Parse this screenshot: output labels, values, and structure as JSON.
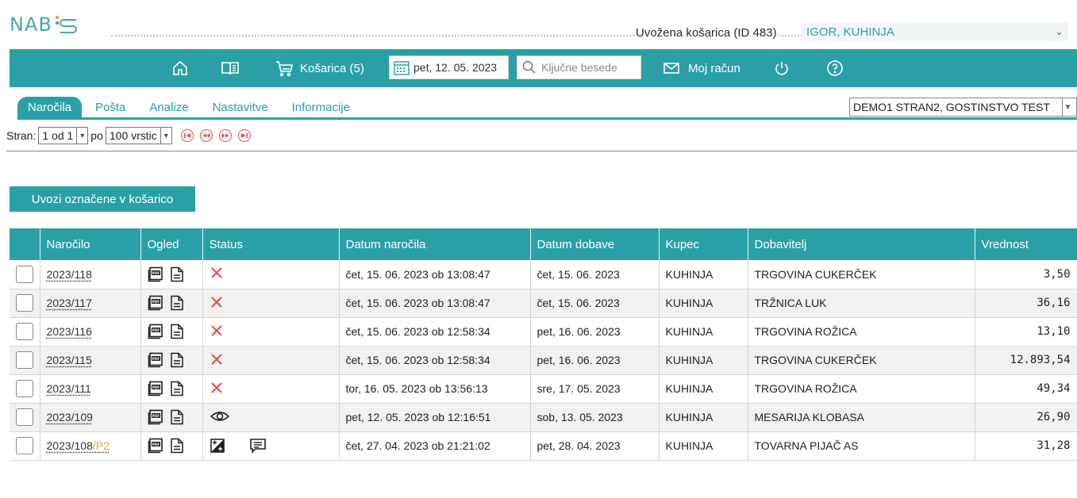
{
  "logo": {
    "text": "NAB",
    "s": "S"
  },
  "imported_cart": {
    "label": "Uvožena košarica (ID 483)",
    "value": "IGOR, KUHINJA"
  },
  "navbar": {
    "cart_label": "Košarica (5)",
    "date": "pet, 12. 05. 2023",
    "search_placeholder": "Ključne besede",
    "account_label": "Moj račun",
    "icons": [
      "home-icon",
      "catalog-book-icon",
      "cart-icon",
      "calendar-icon",
      "search-icon",
      "mail-icon",
      "power-icon",
      "help-icon"
    ]
  },
  "tabs": [
    {
      "label": "Naročila",
      "active": true
    },
    {
      "label": "Pošta",
      "active": false
    },
    {
      "label": "Analize",
      "active": false
    },
    {
      "label": "Nastavitve",
      "active": false
    },
    {
      "label": "Informacije",
      "active": false
    }
  ],
  "company": {
    "value": "DEMO1 STRAN2, GOSTINSTVO TEST"
  },
  "pager": {
    "label": "Stran:",
    "page": "1 od 1",
    "per_label": "po",
    "rows": "100 vrstic"
  },
  "import_button": "Uvozi označene v košarico",
  "table": {
    "headers": [
      "",
      "Naročilo",
      "Ogled",
      "Status",
      "Datum naročila",
      "Datum dobave",
      "Kupec",
      "Dobavitelj",
      "Vrednost"
    ],
    "rows": [
      {
        "order": "2023/118",
        "suffix": "",
        "status": "cancelled",
        "ordered": "čet, 15. 06. 2023 ob 13:08:47",
        "delivery": "čet, 15. 06. 2023",
        "buyer": "KUHINJA",
        "supplier": "TRGOVINA CUKERČEK",
        "value": "3,50"
      },
      {
        "order": "2023/117",
        "suffix": "",
        "status": "cancelled",
        "ordered": "čet, 15. 06. 2023 ob 13:08:47",
        "delivery": "čet, 15. 06. 2023",
        "buyer": "KUHINJA",
        "supplier": "TRŽNICA LUK",
        "value": "36,16"
      },
      {
        "order": "2023/116",
        "suffix": "",
        "status": "cancelled",
        "ordered": "čet, 15. 06. 2023 ob 12:58:34",
        "delivery": "pet, 16. 06. 2023",
        "buyer": "KUHINJA",
        "supplier": "TRGOVINA ROŽICA",
        "value": "13,10"
      },
      {
        "order": "2023/115",
        "suffix": "",
        "status": "cancelled",
        "ordered": "čet, 15. 06. 2023 ob 12:58:34",
        "delivery": "pet, 16. 06. 2023",
        "buyer": "KUHINJA",
        "supplier": "TRGOVINA CUKERČEK",
        "value": "12.893,54"
      },
      {
        "order": "2023/111",
        "suffix": "",
        "status": "cancelled",
        "ordered": "tor, 16. 05. 2023 ob 13:56:13",
        "delivery": "sre, 17. 05. 2023",
        "buyer": "KUHINJA",
        "supplier": "TRGOVINA ROŽICA",
        "value": "49,34"
      },
      {
        "order": "2023/109",
        "suffix": "",
        "status": "viewed",
        "ordered": "pet, 12. 05. 2023 ob 12:16:51",
        "delivery": "sob, 13. 05. 2023",
        "buyer": "KUHINJA",
        "supplier": "MESARIJA KLOBASA",
        "value": "26,90"
      },
      {
        "order": "2023/108",
        "suffix": "/P2",
        "status": "edited",
        "ordered": "čet, 27. 04. 2023 ob 21:21:02",
        "delivery": "pet, 28. 04. 2023",
        "buyer": "KUHINJA",
        "supplier": "TOVARNA PIJAČ AS",
        "value": "31,28"
      }
    ]
  },
  "colors": {
    "accent": "#2aa0a6",
    "cancel": "#e34b4b",
    "suffix": "#e8a340"
  }
}
